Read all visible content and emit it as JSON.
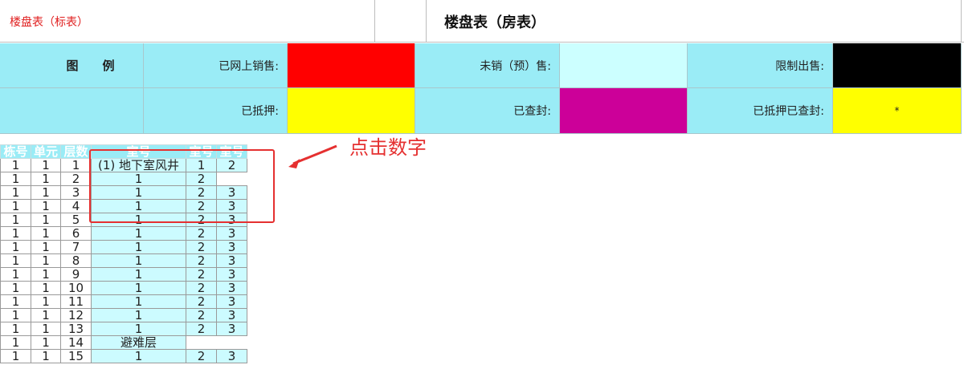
{
  "header": {
    "left_title": "楼盘表（标表）",
    "right_title": "楼盘表（房表）"
  },
  "legend": {
    "title": "图　例",
    "items": [
      {
        "label": "已网上销售:",
        "color": "#ff0000",
        "mark": ""
      },
      {
        "label": "未销（预）售:",
        "color": "#ccffff",
        "mark": ""
      },
      {
        "label": "限制出售:",
        "color": "#000000",
        "mark": ""
      },
      {
        "label": "已抵押:",
        "color": "#ffff00",
        "mark": ""
      },
      {
        "label": "已查封:",
        "color": "#cc0099",
        "mark": ""
      },
      {
        "label": "已抵押已查封:",
        "color": "#ffff00",
        "mark": "*"
      }
    ]
  },
  "table": {
    "headers": [
      "栋号",
      "单元",
      "层数",
      "室号",
      "室号",
      "室号"
    ],
    "rows": [
      [
        "1",
        "1",
        "1",
        "(1) 地下室风井",
        "1",
        "2"
      ],
      [
        "1",
        "1",
        "2",
        "1",
        "2",
        ""
      ],
      [
        "1",
        "1",
        "3",
        "1",
        "2",
        "3"
      ],
      [
        "1",
        "1",
        "4",
        "1",
        "2",
        "3"
      ],
      [
        "1",
        "1",
        "5",
        "1",
        "2",
        "3"
      ],
      [
        "1",
        "1",
        "6",
        "1",
        "2",
        "3"
      ],
      [
        "1",
        "1",
        "7",
        "1",
        "2",
        "3"
      ],
      [
        "1",
        "1",
        "8",
        "1",
        "2",
        "3"
      ],
      [
        "1",
        "1",
        "9",
        "1",
        "2",
        "3"
      ],
      [
        "1",
        "1",
        "10",
        "1",
        "2",
        "3"
      ],
      [
        "1",
        "1",
        "11",
        "1",
        "2",
        "3"
      ],
      [
        "1",
        "1",
        "12",
        "1",
        "2",
        "3"
      ],
      [
        "1",
        "1",
        "13",
        "1",
        "2",
        "3"
      ],
      [
        "1",
        "1",
        "14",
        "避难层",
        "",
        ""
      ],
      [
        "1",
        "1",
        "15",
        "1",
        "2",
        "3"
      ]
    ]
  },
  "annotation": {
    "text": "点击数字",
    "color": "#e53030"
  }
}
